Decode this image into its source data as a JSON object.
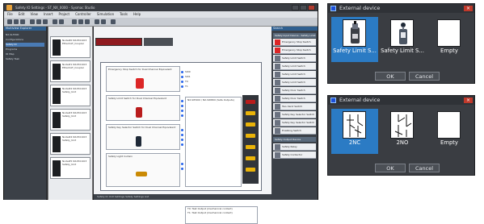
{
  "app": {
    "title": "Safety IO Settings - ST_NX_0000 - Sysmac Studio",
    "menu": [
      "File",
      "Edit",
      "View",
      "Insert",
      "Project",
      "Controller",
      "Simulation",
      "Tools",
      "Help"
    ],
    "left_pane": {
      "header": "Multiview Explorer",
      "items": [
        "NX-SL5500",
        "Configurations",
        "Safety IO",
        "Programs",
        "IO Map",
        "Safety Task"
      ]
    },
    "units": [
      {
        "label": "Node#0 NX-ECC203 EtherCAT_Coupler"
      },
      {
        "label": "Node#1 NX-ECC203 EtherCAT_Coupler"
      },
      {
        "label": "Node#2 NX-ECC203 Safety_Unit"
      },
      {
        "label": "Node#3 NX-ECC203 Safety_Unit"
      },
      {
        "label": "Node#4 NX-ECC203 Safety_Unit"
      },
      {
        "label": "Node#5 NX-ECC203 Safety_Unit"
      }
    ],
    "devices": [
      {
        "name": "Emergency Stop Switch for Dual Channel Equivalent",
        "pins": [
          "SI00",
          "SI01",
          "T0",
          "T1"
        ]
      },
      {
        "name": "Safety Limit Switch for Dual Channel Equivalent",
        "pins": [
          "SI02",
          "SI03",
          "T0",
          "T1"
        ]
      },
      {
        "name": "Safety Key Selector Switch for Dual Channel Equivalent",
        "pins": [
          "SI04",
          "SI05",
          "T0",
          "T1"
        ]
      },
      {
        "name": "Safety Light Curtain",
        "pins": [
          "SI06",
          "SI07"
        ]
      }
    ],
    "logic_box_title": "NX-SIH400 / NX-SID800 (Safe Outputs)",
    "node_list": [
      "T0: Test Output (mechanical contact)",
      "T1: Test Output (mechanical contact)"
    ],
    "bottom_tabs": "Safety IO   Unit Settings   Safety Settings List",
    "right_pane": {
      "search_label": "Search",
      "section1": "Safety Input Device - Safety Limit Switch",
      "items": [
        "Emergency Stop Switch",
        "Emergency Stop Switch",
        "Safety Limit Switch",
        "Safety Limit Switch",
        "Safety Limit Switch",
        "Safety Limit Switch",
        "Safety Door Switch",
        "Safety Door Switch",
        "Two-hand Switch",
        "Safety Key Selector Switch",
        "Safety Key Selector Switch",
        "Enabling Switch"
      ],
      "section2": "Safety Output Device",
      "items2": [
        "Safety Relay",
        "Safety Contactor"
      ]
    }
  },
  "dialog1": {
    "title": "External device",
    "close": "×",
    "options": [
      {
        "label": "Safety Limit S...",
        "selected": true,
        "icon": "safety-limit-switch-icon"
      },
      {
        "label": "Safety Limit S...",
        "selected": false,
        "icon": "safety-limit-switch-roller-icon"
      },
      {
        "label": "Empty",
        "selected": false,
        "icon": "empty-icon"
      }
    ],
    "ok": "OK",
    "cancel": "Cancel"
  },
  "dialog2": {
    "title": "External device",
    "close": "×",
    "options": [
      {
        "label": "2NC",
        "selected": true,
        "icon": "contact-2nc-icon"
      },
      {
        "label": "2NO",
        "selected": false,
        "icon": "contact-2no-icon"
      },
      {
        "label": "Empty",
        "selected": false,
        "icon": "empty-icon"
      }
    ],
    "ok": "OK",
    "cancel": "Cancel"
  }
}
